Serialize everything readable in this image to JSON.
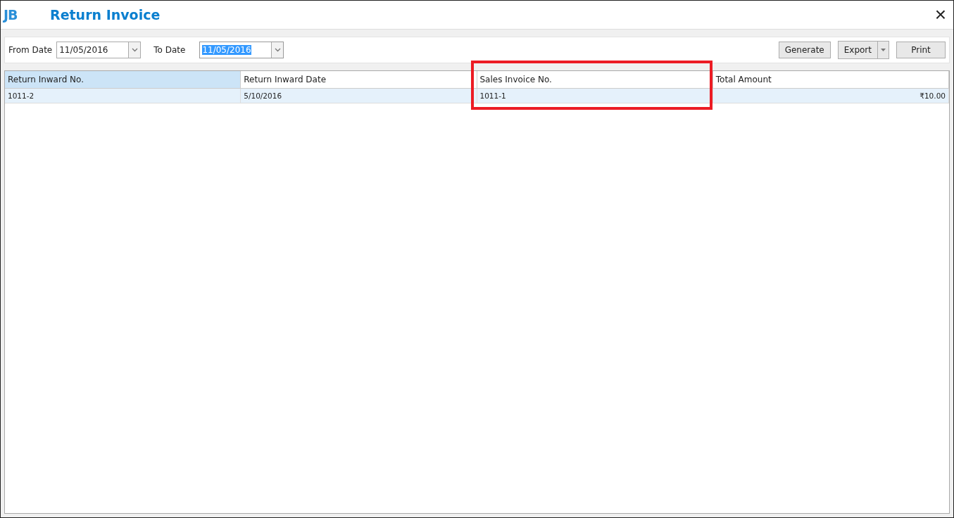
{
  "window": {
    "logo": "JB",
    "title": "Return Invoice",
    "close": "×"
  },
  "filters": [
    {
      "label": "From Date",
      "value": "11/05/2016",
      "selected": false
    },
    {
      "label": "To Date",
      "value": "11/05/2016",
      "selected": true
    }
  ],
  "buttons": [
    {
      "label": "Generate",
      "kind": "plain"
    },
    {
      "label": "Export",
      "kind": "split"
    },
    {
      "label": "Print",
      "kind": "plain"
    }
  ],
  "table": {
    "columns": [
      {
        "label": "Return Inward No.",
        "selected": true,
        "annotated": false,
        "kind": "text"
      },
      {
        "label": "Return Inward Date",
        "selected": false,
        "annotated": false,
        "kind": "text"
      },
      {
        "label": "Sales Invoice No.",
        "selected": false,
        "annotated": true,
        "kind": "text"
      },
      {
        "label": "Total Amount",
        "selected": false,
        "annotated": false,
        "kind": "amount"
      }
    ],
    "rows": [
      {
        "cells": [
          "1011-2",
          "5/10/2016",
          "1011-1",
          "₹10.00"
        ],
        "selected": true
      }
    ]
  }
}
